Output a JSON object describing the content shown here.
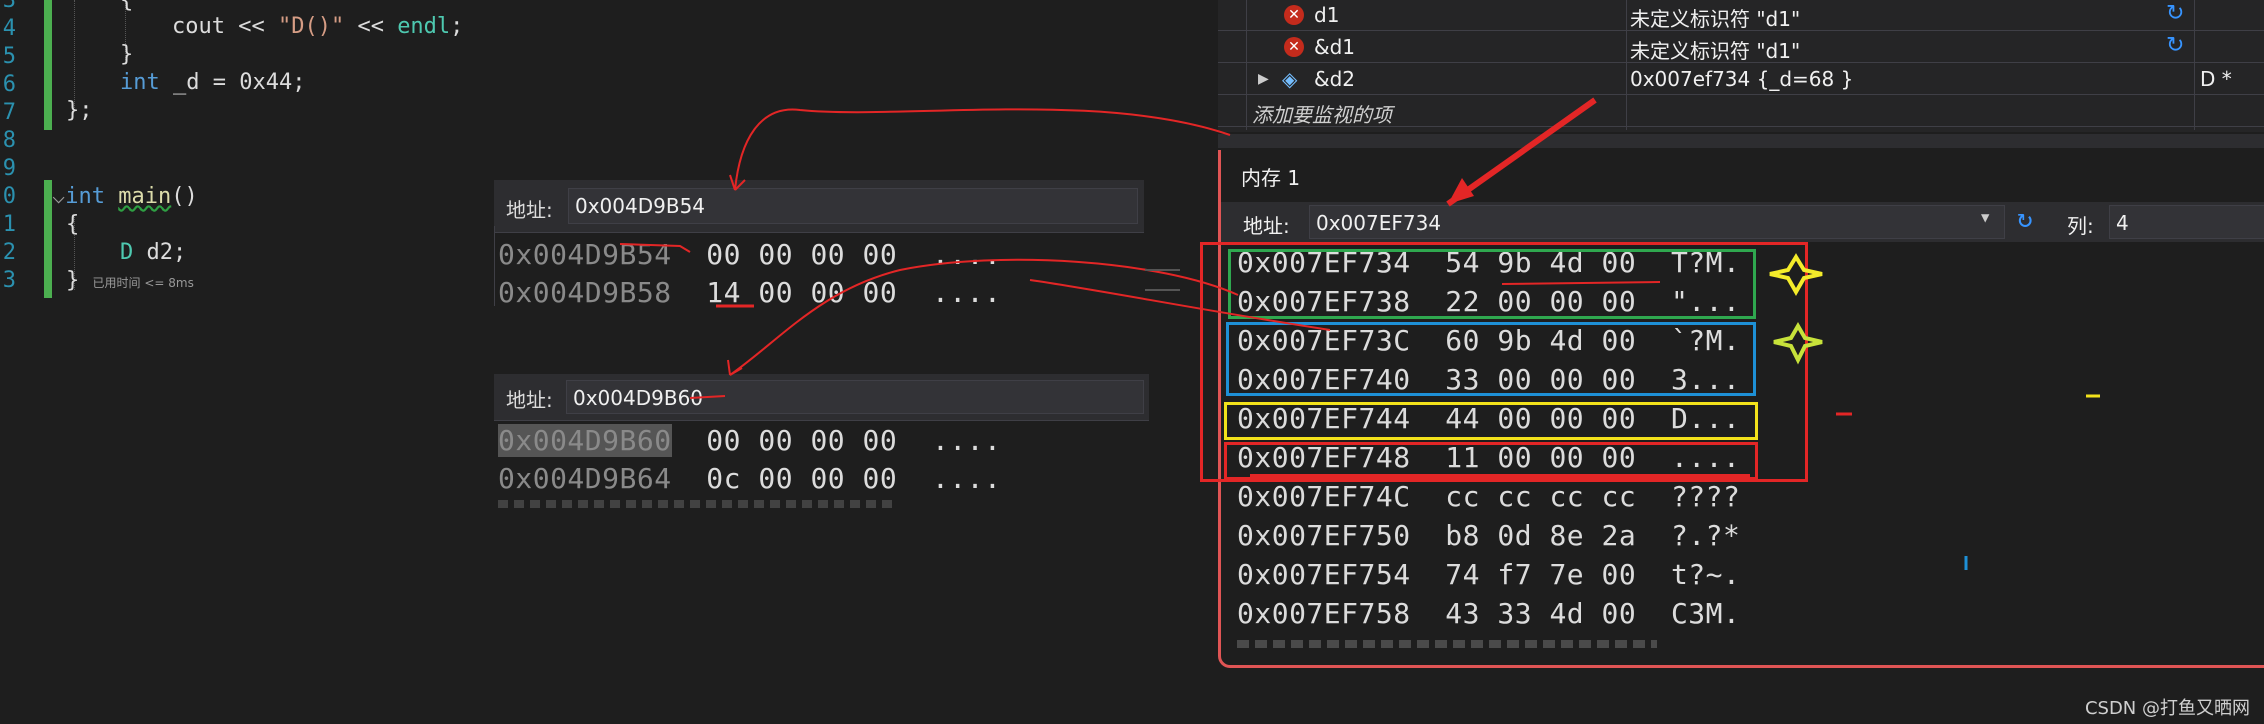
{
  "editor": {
    "line_numbers": [
      "3",
      "4",
      "5",
      "6",
      "7",
      "8",
      "9",
      "0",
      "1",
      "2",
      "3"
    ],
    "lines": {
      "brace_open": "{",
      "cout_kw": "cout",
      "cout_rest": " << ",
      "cout_str": "\"D()\"",
      "cout_tail": " << ",
      "endl": "endl",
      "semi": ";",
      "brace_close": "}",
      "int_kw": "int",
      "int_rest": " _d = 0x44;",
      "class_close": "};",
      "main_int": "int",
      "main_fn": "main",
      "main_paren": "()",
      "main_brace": "{",
      "d_type": "D",
      "d_rest": " d2;",
      "end_brace": "}",
      "elapsed_hint": "已用时间 <= 8ms"
    }
  },
  "popup1": {
    "label": "地址:",
    "address": "0x004D9B54",
    "rows": [
      {
        "addr": "0x004D9B54",
        "bytes": "00 00 00 00",
        "ascii": "...."
      },
      {
        "addr": "0x004D9B58",
        "bytes": "14 00 00 00",
        "ascii": "...."
      }
    ]
  },
  "popup2": {
    "label": "地址:",
    "address": "0x004D9B60",
    "rows": [
      {
        "addr": "0x004D9B60",
        "bytes": "00 00 00 00",
        "ascii": "...."
      },
      {
        "addr": "0x004D9B64",
        "bytes": "0c 00 00 00",
        "ascii": "...."
      }
    ]
  },
  "watch": {
    "rows": [
      {
        "name": "d1",
        "value": "未定义标识符 \"d1\"",
        "type": "",
        "state": "error"
      },
      {
        "name": "&d1",
        "value": "未定义标识符 \"d1\"",
        "type": "",
        "state": "error"
      },
      {
        "name": "&d2",
        "value": "0x007ef734 {_d=68 }",
        "type": "D *",
        "state": "object"
      }
    ],
    "add_item": "添加要监视的项"
  },
  "memory": {
    "title": "内存 1",
    "address_label": "地址:",
    "address": "0x007EF734",
    "columns_label": "列:",
    "columns": "4",
    "rows": [
      {
        "addr": "0x007EF734",
        "bytes": "54 9b 4d 00",
        "ascii": "T?M."
      },
      {
        "addr": "0x007EF738",
        "bytes": "22 00 00 00",
        "ascii": "\"..."
      },
      {
        "addr": "0x007EF73C",
        "bytes": "60 9b 4d 00",
        "ascii": "`?M."
      },
      {
        "addr": "0x007EF740",
        "bytes": "33 00 00 00",
        "ascii": "3..."
      },
      {
        "addr": "0x007EF744",
        "bytes": "44 00 00 00",
        "ascii": "D..."
      },
      {
        "addr": "0x007EF748",
        "bytes": "11 00 00 00",
        "ascii": "...."
      },
      {
        "addr": "0x007EF74C",
        "bytes": "cc cc cc cc",
        "ascii": "????"
      },
      {
        "addr": "0x007EF750",
        "bytes": "b8 0d 8e 2a",
        "ascii": "?.?*"
      },
      {
        "addr": "0x007EF754",
        "bytes": "74 f7 7e 00",
        "ascii": "t?~."
      },
      {
        "addr": "0x007EF758",
        "bytes": "43 33 4d 00",
        "ascii": "C3M."
      }
    ]
  },
  "watermark": "CSDN @打鱼又晒网",
  "colors": {
    "annotation_red": "#e32626",
    "annotation_green": "#2fa84f",
    "annotation_blue": "#1e90d6",
    "annotation_yellow": "#f2e21b",
    "star_yellow": "#f4ec2a",
    "star_green": "#c7e23a"
  }
}
